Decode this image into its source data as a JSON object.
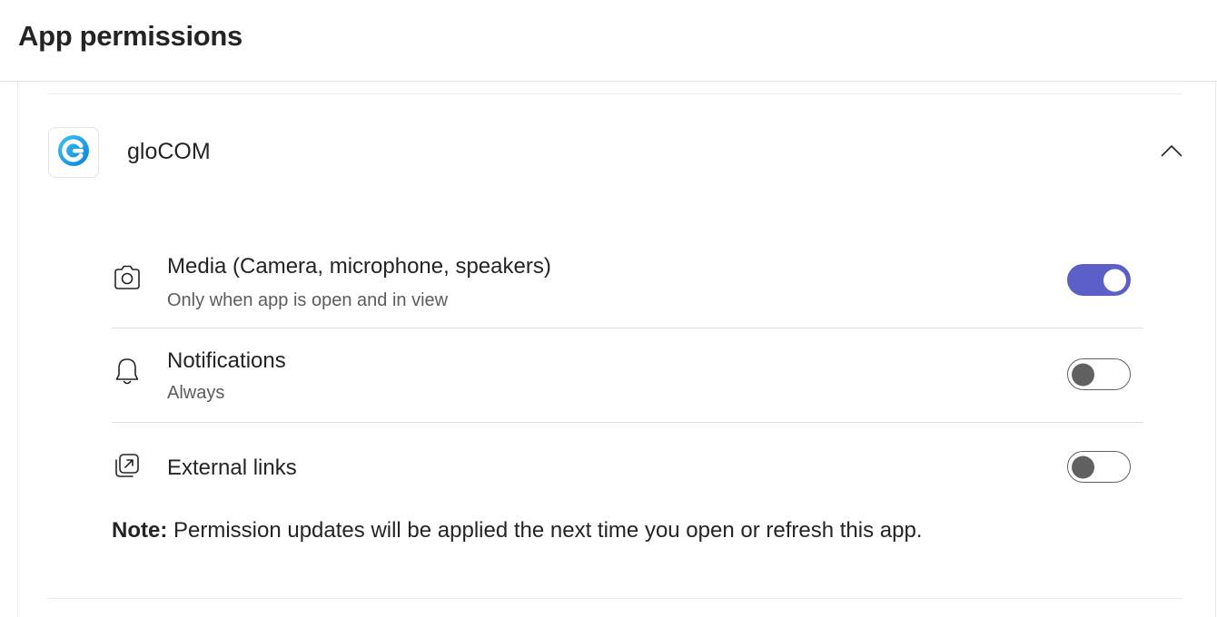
{
  "header": {
    "title": "App permissions"
  },
  "app": {
    "name": "gloCOM",
    "icon": "glocom-logo-icon",
    "expanded": true,
    "collapse_icon": "chevron-up-icon"
  },
  "permissions": [
    {
      "icon": "camera-icon",
      "title": "Media (Camera, microphone, speakers)",
      "subtitle": "Only when app is open and in view",
      "enabled": true
    },
    {
      "icon": "bell-icon",
      "title": "Notifications",
      "subtitle": "Always",
      "enabled": false
    },
    {
      "icon": "external-link-icon",
      "title": "External links",
      "subtitle": "",
      "enabled": false
    }
  ],
  "note": {
    "label": "Note:",
    "text": " Permission updates will be applied the next time you open or refresh this app."
  },
  "colors": {
    "accent": "#5b5fc7",
    "toggle_off": "#616161",
    "logo_blue": "#1a9be8"
  }
}
